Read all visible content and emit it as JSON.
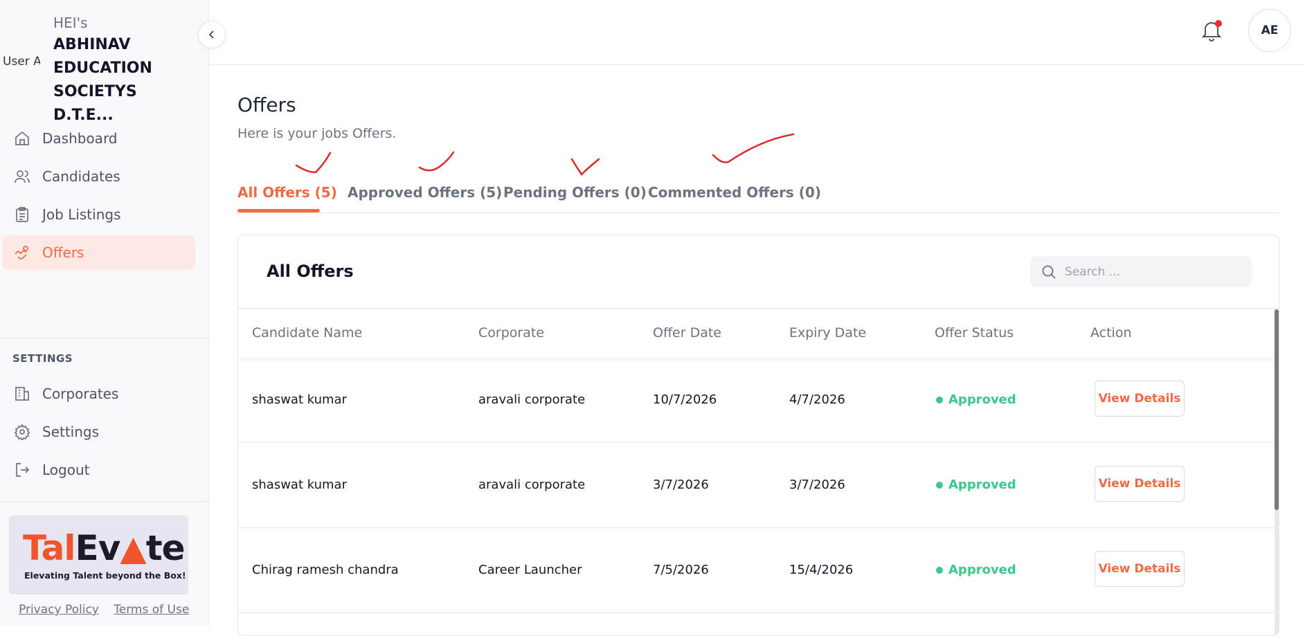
{
  "sidebar": {
    "avatar_alt": "User Avatar",
    "org_prefix": "HEI's",
    "org_name": "ABHINAV EDUCATION SOCIETYS D.T.E...",
    "nav": [
      {
        "label": "Dashboard",
        "icon": "home-icon"
      },
      {
        "label": "Candidates",
        "icon": "users-icon"
      },
      {
        "label": "Job Listings",
        "icon": "clipboard-icon"
      },
      {
        "label": "Offers",
        "icon": "handshake-icon",
        "active": true
      }
    ],
    "settings_heading": "SETTINGS",
    "settings_nav": [
      {
        "label": "Corporates",
        "icon": "building-icon"
      },
      {
        "label": "Settings",
        "icon": "gear-icon"
      },
      {
        "label": "Logout",
        "icon": "logout-icon"
      }
    ],
    "logo": {
      "word_a": "Tal",
      "word_b": "Ev",
      "word_c": "te",
      "tagline": "Elevating Talent beyond the Box!"
    },
    "footer": {
      "privacy": "Privacy Policy",
      "terms": "Terms of Use"
    }
  },
  "header": {
    "user_initials": "AE"
  },
  "page": {
    "title": "Offers",
    "subtitle": "Here is your jobs Offers.",
    "tabs": [
      {
        "label": "All Offers (5)",
        "active": true
      },
      {
        "label": "Approved Offers (5)"
      },
      {
        "label": "Pending Offers (0)"
      },
      {
        "label": "Commented Offers (0)"
      }
    ]
  },
  "table": {
    "title": "All Offers",
    "search_placeholder": "Search ...",
    "columns": [
      "Candidate Name",
      "Corporate",
      "Offer Date",
      "Expiry Date",
      "Offer Status",
      "Action"
    ],
    "rows": [
      {
        "candidate": "shaswat kumar",
        "corporate": "aravali corporate",
        "offer_date": "10/7/2026",
        "expiry_date": "4/7/2026",
        "status": "Approved",
        "action": "View Details"
      },
      {
        "candidate": "shaswat kumar",
        "corporate": "aravali corporate",
        "offer_date": "3/7/2026",
        "expiry_date": "3/7/2026",
        "status": "Approved",
        "action": "View Details"
      },
      {
        "candidate": "Chirag ramesh chandra",
        "corporate": "Career Launcher",
        "offer_date": "7/5/2026",
        "expiry_date": "15/4/2026",
        "status": "Approved",
        "action": "View Details"
      }
    ]
  },
  "colors": {
    "accent": "#f26a44",
    "approved": "#39c98a",
    "annotation": "#e0262b"
  }
}
